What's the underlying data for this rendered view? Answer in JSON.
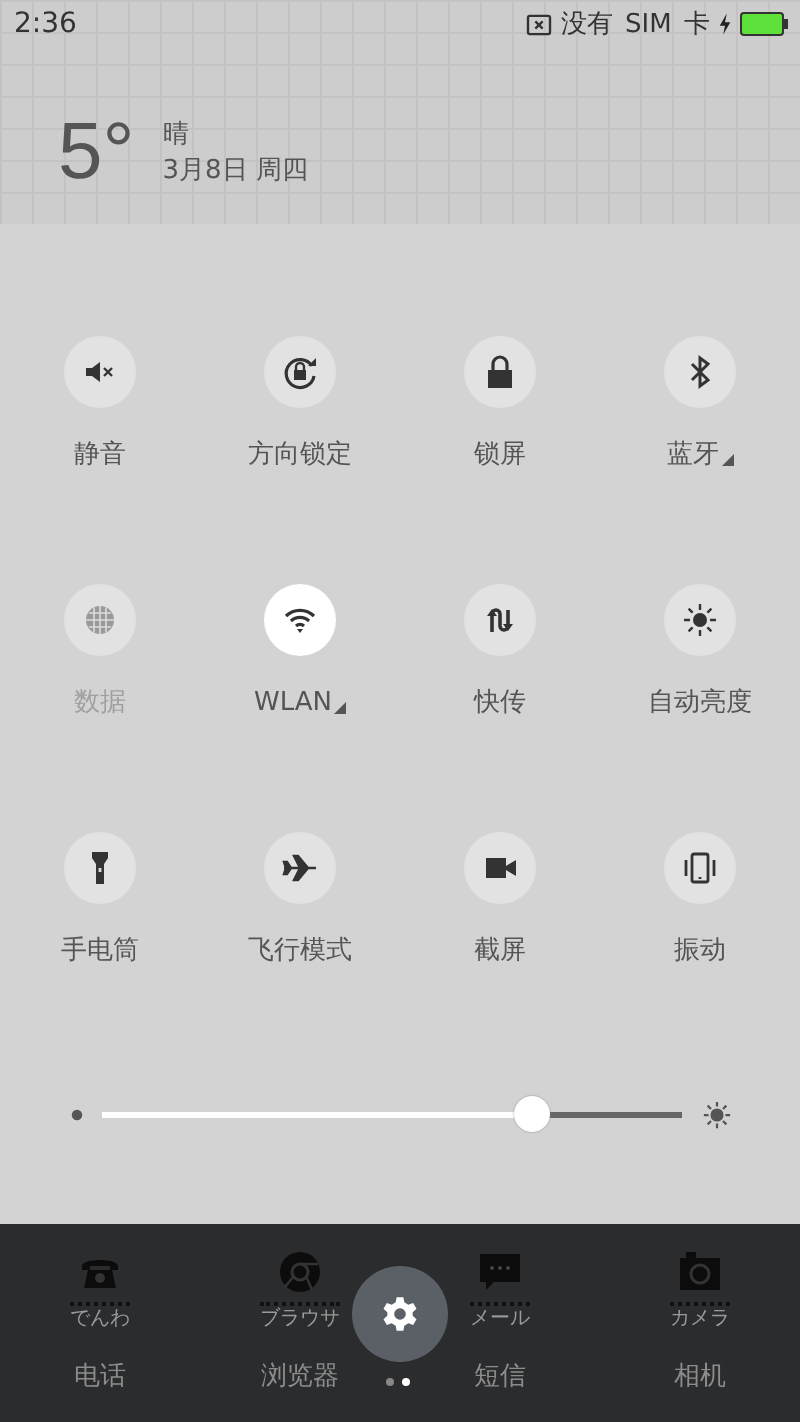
{
  "status_bar": {
    "time": "2:36",
    "sim_status": "没有 SIM 卡",
    "charging": true
  },
  "weather": {
    "temperature": "5°",
    "condition": "晴",
    "date": "3月8日 周四"
  },
  "toggles": [
    {
      "label": "静音",
      "on": false,
      "disabled": false,
      "expandable": false
    },
    {
      "label": "方向锁定",
      "on": false,
      "disabled": false,
      "expandable": false
    },
    {
      "label": "锁屏",
      "on": false,
      "disabled": false,
      "expandable": false
    },
    {
      "label": "蓝牙",
      "on": false,
      "disabled": false,
      "expandable": true
    },
    {
      "label": "数据",
      "on": false,
      "disabled": true,
      "expandable": false
    },
    {
      "label": "WLAN",
      "on": true,
      "disabled": false,
      "expandable": true
    },
    {
      "label": "快传",
      "on": false,
      "disabled": false,
      "expandable": false
    },
    {
      "label": "自动亮度",
      "on": false,
      "disabled": false,
      "expandable": false
    },
    {
      "label": "手电筒",
      "on": false,
      "disabled": false,
      "expandable": false
    },
    {
      "label": "飞行模式",
      "on": false,
      "disabled": false,
      "expandable": false
    },
    {
      "label": "截屏",
      "on": false,
      "disabled": false,
      "expandable": false
    },
    {
      "label": "振动",
      "on": false,
      "disabled": false,
      "expandable": false
    }
  ],
  "brightness": {
    "level": 0.74
  },
  "dock": [
    {
      "caption": "でんわ",
      "label": "电话"
    },
    {
      "caption": "ブラウサ",
      "label": "浏览器"
    },
    {
      "caption": "メール",
      "label": "短信"
    },
    {
      "caption": "カメラ",
      "label": "相机"
    }
  ],
  "pages": [
    {
      "selected": false
    },
    {
      "selected": true
    }
  ]
}
